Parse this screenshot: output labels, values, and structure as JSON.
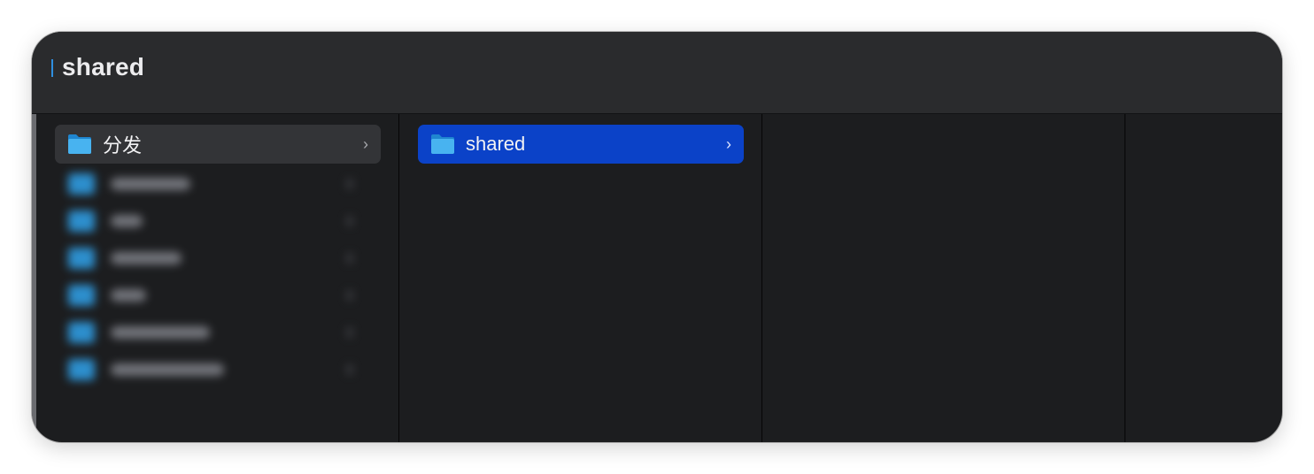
{
  "window": {
    "title": "shared"
  },
  "columns": [
    {
      "items": [
        {
          "label": "分发",
          "state": "parent-selected",
          "has_children": true,
          "icon": "folder-icon"
        }
      ],
      "hidden_items_count_visible": 6
    },
    {
      "items": [
        {
          "label": "shared",
          "state": "active-selected",
          "has_children": true,
          "icon": "folder-icon"
        }
      ]
    },
    {
      "items": []
    },
    {
      "items": []
    }
  ],
  "icons": {
    "chevron": "›"
  },
  "colors": {
    "window_bg": "#1c1d1f",
    "titlebar_bg": "#2a2b2d",
    "selection_active": "#0b42c8",
    "selection_parent": "#333437",
    "folder_blue": "#2f9be0"
  }
}
